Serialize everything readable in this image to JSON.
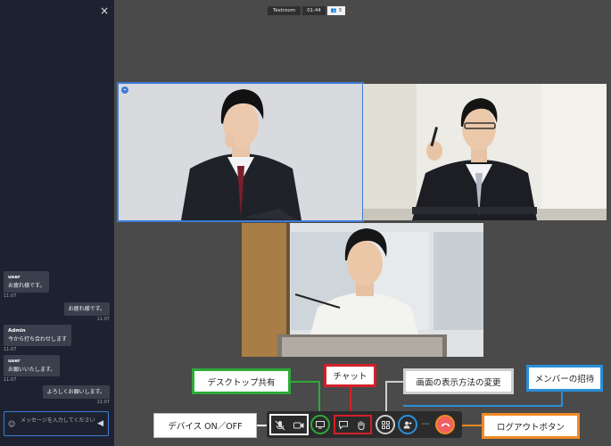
{
  "chat": {
    "close_symbol": "×",
    "messages": [
      {
        "sender": "user",
        "text": "お疲れ様です。",
        "time": "11:07",
        "align": "left"
      },
      {
        "sender": "",
        "text": "お疲れ様です。",
        "time": "11:07",
        "align": "right"
      },
      {
        "sender": "Admin",
        "text": "今から打ち合わせします",
        "time": "11:07",
        "align": "left"
      },
      {
        "sender": "user",
        "text": "お願いいたします。",
        "time": "11:07",
        "align": "left"
      },
      {
        "sender": "",
        "text": "よろしくお願いします。",
        "time": "11:07",
        "align": "right"
      }
    ],
    "input_placeholder": "メッセージを入力してください",
    "emoji_icon": "☺",
    "send_icon": "◀"
  },
  "meeting": {
    "room_name": "Testroom",
    "timer": "01:44",
    "participant_count": "👥 3"
  },
  "callouts": {
    "desktop_share": "デスクトップ共有",
    "chat": "チャット",
    "layout": "画面の表示方法の変更",
    "invite": "メンバーの招待",
    "device": "デバイス ON／OFF",
    "logout": "ログアウトボタン"
  },
  "colors": {
    "green": "#2eaa3a",
    "red": "#d3202a",
    "blue": "#2a8fd8",
    "orange": "#f08a24",
    "grey": "#cfcfcf",
    "hangup": "#f06060",
    "active_tile": "#3d7bd6"
  },
  "icons": [
    "mic-off-icon",
    "camera-icon",
    "screen-share-icon",
    "chat-icon",
    "raise-hand-icon",
    "grid-layout-icon",
    "add-member-icon",
    "more-icon",
    "hang-up-icon"
  ]
}
